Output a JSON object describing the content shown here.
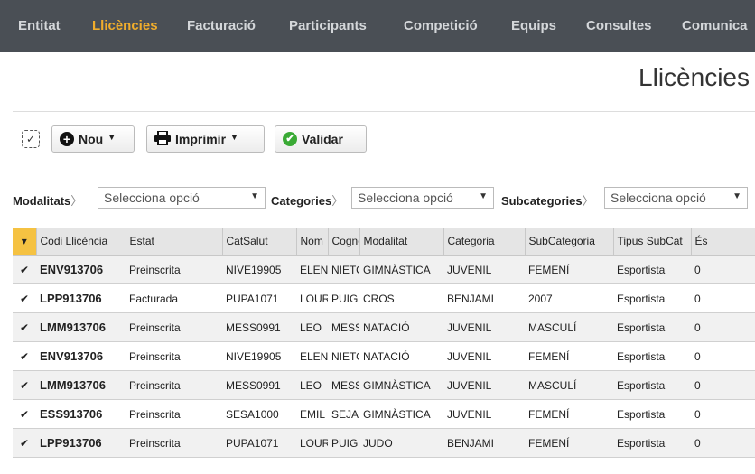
{
  "nav": {
    "items": [
      {
        "label": "Entitat",
        "active": false
      },
      {
        "label": "Llicències",
        "active": true
      },
      {
        "label": "Facturació",
        "active": false
      },
      {
        "label": "Participants",
        "active": false
      },
      {
        "label": "Competició",
        "active": false
      },
      {
        "label": "Equips",
        "active": false
      },
      {
        "label": "Consultes",
        "active": false
      },
      {
        "label": "Comunica",
        "active": false
      }
    ]
  },
  "page": {
    "title": "Llicències"
  },
  "toolbar": {
    "select_all_glyph": "✓",
    "new_label": "Nou",
    "print_label": "Imprimir",
    "validate_label": "Validar"
  },
  "filters": {
    "modalitats_label": "Modalitats",
    "categories_label": "Categories",
    "subcategories_label": "Subcategories",
    "modalitats_value": "Selecciona opció",
    "categories_value": "Selecciona opció",
    "subcategories_value": "Selecciona opció"
  },
  "table": {
    "columns": [
      "$",
      "Codi Llicència",
      "Estat",
      "CatSalut",
      "Nom",
      "Cognom",
      "Modalitat",
      "Categoria",
      "SubCategoria",
      "Tipus SubCat",
      "És"
    ],
    "rows": [
      {
        "codi": "ENV913706",
        "estat": "Preinscrita",
        "catsalut": "NIVE19905",
        "nom": "ELEN",
        "cognom": "NIETO",
        "modalitat": "GIMNÀSTICA",
        "categoria": "JUVENIL",
        "subcategoria": "FEMENÍ",
        "tipus": "Esportista",
        "es": "0"
      },
      {
        "codi": "LPP913706",
        "estat": "Facturada",
        "catsalut": "PUPA1071",
        "nom": "LOUR",
        "cognom": "PUIG",
        "modalitat": "CROS",
        "categoria": "BENJAMI",
        "subcategoria": "2007",
        "tipus": "Esportista",
        "es": "0"
      },
      {
        "codi": "LMM913706",
        "estat": "Preinscrita",
        "catsalut": "MESS0991",
        "nom": "LEO",
        "cognom": "MESS",
        "modalitat": "NATACIÓ",
        "categoria": "JUVENIL",
        "subcategoria": "MASCULÍ",
        "tipus": "Esportista",
        "es": "0"
      },
      {
        "codi": "ENV913706",
        "estat": "Preinscrita",
        "catsalut": "NIVE19905",
        "nom": "ELEN",
        "cognom": "NIETO",
        "modalitat": "NATACIÓ",
        "categoria": "JUVENIL",
        "subcategoria": "FEMENÍ",
        "tipus": "Esportista",
        "es": "0"
      },
      {
        "codi": "LMM913706",
        "estat": "Preinscrita",
        "catsalut": "MESS0991",
        "nom": "LEO",
        "cognom": "MESS",
        "modalitat": "GIMNÀSTICA",
        "categoria": "JUVENIL",
        "subcategoria": "MASCULÍ",
        "tipus": "Esportista",
        "es": "0"
      },
      {
        "codi": "ESS913706",
        "estat": "Preinscrita",
        "catsalut": "SESA1000",
        "nom": "EMIL",
        "cognom": "SEJA",
        "modalitat": "GIMNÀSTICA",
        "categoria": "JUVENIL",
        "subcategoria": "FEMENÍ",
        "tipus": "Esportista",
        "es": "0"
      },
      {
        "codi": "LPP913706",
        "estat": "Preinscrita",
        "catsalut": "PUPA1071",
        "nom": "LOUR",
        "cognom": "PUIG",
        "modalitat": "JUDO",
        "categoria": "BENJAMI",
        "subcategoria": "FEMENÍ",
        "tipus": "Esportista",
        "es": "0"
      }
    ],
    "row_checked_glyph": "✔",
    "sort_glyph": "▾"
  },
  "colors": {
    "nav_bg": "#4a4f55",
    "nav_active": "#f0ad2c",
    "estat_preinscrita": "#e04a2c",
    "estat_facturada": "#f0a030"
  }
}
